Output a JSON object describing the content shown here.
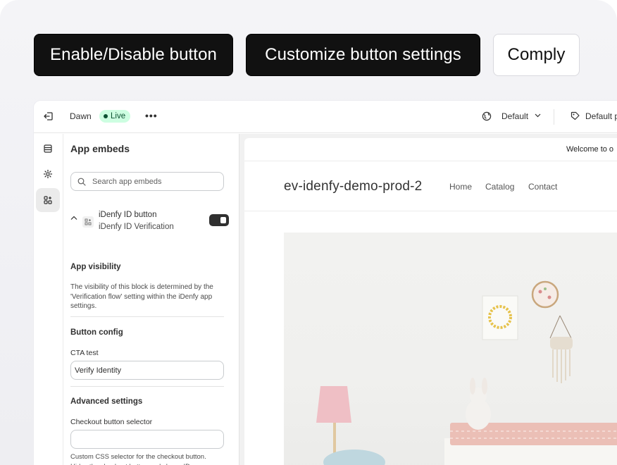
{
  "pills": {
    "enable_disable": "Enable/Disable button",
    "customize": "Customize button settings",
    "comply": "Comply"
  },
  "topbar": {
    "theme_name": "Dawn",
    "live_badge": "Live",
    "more": "•••",
    "language": "Default",
    "product": "Default p"
  },
  "panel": {
    "title": "App embeds",
    "search_placeholder": "Search app embeds",
    "embed": {
      "name": "iDenfy ID button",
      "app": "iDenfy ID Verification",
      "enabled": true
    },
    "app_visibility": {
      "title": "App visibility",
      "text": "The visibility of this block is determined by the 'Verification flow' setting within the iDenfy app settings."
    },
    "button_config": {
      "title": "Button config",
      "cta_label": "CTA test",
      "cta_value": "Verify Identity"
    },
    "advanced": {
      "title": "Advanced settings",
      "selector_label": "Checkout button selector",
      "selector_value": "",
      "help_text": "Custom CSS selector for the checkout button. Hides the checkout button and shows ID"
    }
  },
  "preview": {
    "announcement": "Welcome to o",
    "store_name": "ev-idenfy-demo-prod-2",
    "nav": [
      "Home",
      "Catalog",
      "Contact"
    ]
  },
  "colors": {
    "live_bg": "#cdfee1",
    "live_text": "#0c5132",
    "dark_pill": "#111111",
    "toggle_on": "#303030"
  }
}
